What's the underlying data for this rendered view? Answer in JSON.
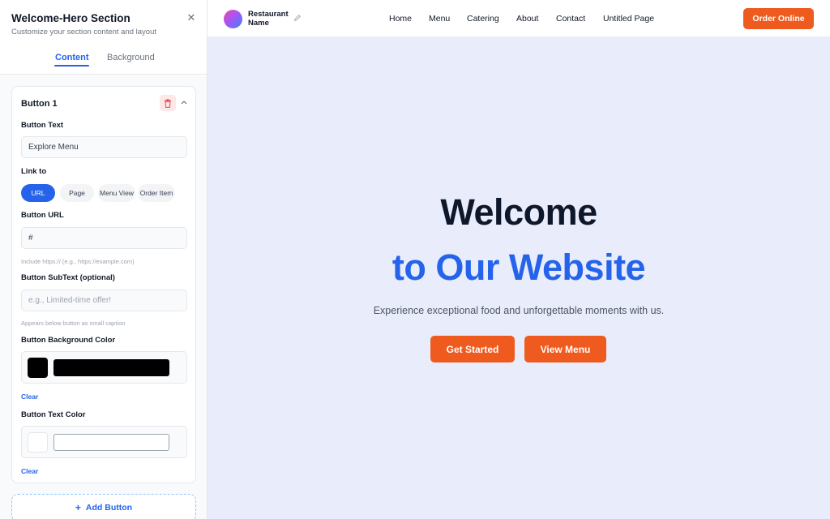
{
  "panel": {
    "title": "Welcome-Hero Section",
    "subtitle": "Customize your section content and layout",
    "close_icon": "close-icon",
    "tabs": [
      {
        "label": "Content",
        "active": true
      },
      {
        "label": "Background",
        "active": false
      }
    ],
    "button_card": {
      "title": "Button 1",
      "delete_icon": "trash-icon",
      "collapse_icon": "chevron-up-icon",
      "button_text_label": "Button Text",
      "button_text_value": "Explore Menu",
      "link_to_label": "Link to",
      "link_options": [
        {
          "label": "URL",
          "active": true
        },
        {
          "label": "Page",
          "active": false
        },
        {
          "label": "Menu View",
          "active": false
        },
        {
          "label": "Order Item",
          "active": false
        }
      ],
      "button_url_label": "Button URL",
      "button_url_value": "#",
      "button_url_hint": "Include https:// (e.g., https://example.com)",
      "subtext_label": "Button SubText (optional)",
      "subtext_placeholder": "e.g., Limited-time offer!",
      "subtext_hint": "Appears below button as small caption",
      "bg_color_label": "Button Background Color",
      "bg_color_value": "#000000",
      "bg_clear": "Clear",
      "text_color_label": "Button Text Color",
      "text_color_value": "#ffffff",
      "text_clear": "Clear"
    },
    "add_button_label": "Add Button",
    "add_icon": "plus-icon"
  },
  "preview": {
    "logo_icon": "restaurant-logo-icon",
    "brand_line1": "Restaurant",
    "brand_line2": "Name",
    "edit_icon": "pencil-icon",
    "nav": [
      "Home",
      "Menu",
      "Catering",
      "About",
      "Contact",
      "Untitled Page"
    ],
    "order_button": "Order Online",
    "hero_title_line1": "Welcome",
    "hero_title_line2": "to Our Website",
    "hero_subtitle": "Experience exceptional food and unforgettable moments with us.",
    "cta_primary": "Get Started",
    "cta_secondary": "View Menu"
  },
  "colors": {
    "accent": "#2563eb",
    "orange": "#ef5a1e",
    "preview_bg": "#e9edfb",
    "dark": "#0f172a"
  }
}
